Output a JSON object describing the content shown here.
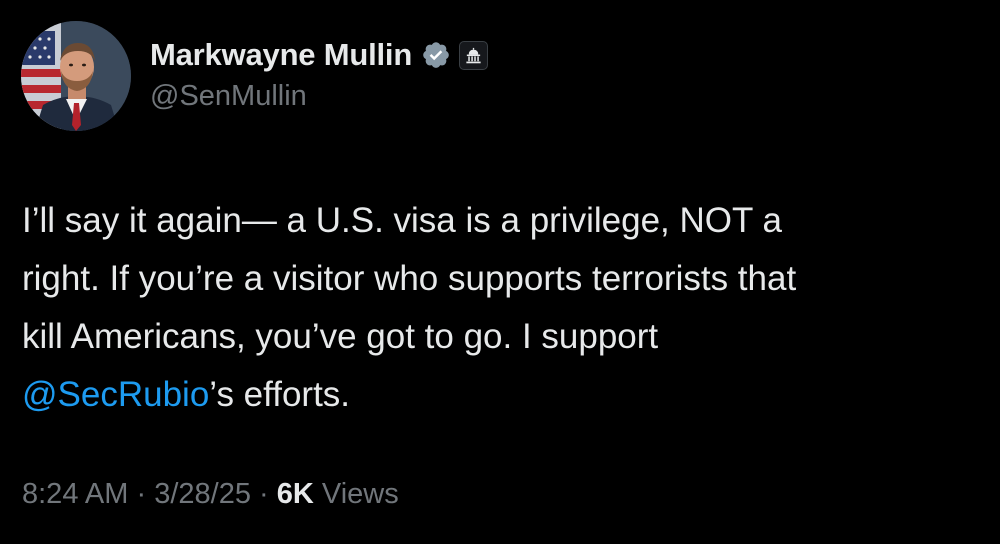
{
  "author": {
    "display_name": "Markwayne Mullin",
    "handle": "@SenMullin",
    "verified_icon": "verified-checkmark-icon",
    "affiliation_icon": "government-building-icon",
    "verified_color": "#8899a6"
  },
  "tweet": {
    "lines": [
      "I’ll say it again— a U.S. visa is a privilege, NOT a",
      "right. If you’re a visitor who supports terrorists that",
      "kill Americans, you’ve got to go. I support"
    ],
    "mention": "@SecRubio",
    "after_mention": "’s efforts."
  },
  "meta": {
    "time": "8:24 AM",
    "separator": "·",
    "date": "3/28/25",
    "views_count": "6K",
    "views_label": "Views"
  },
  "colors": {
    "background": "#000000",
    "text": "#e7e9ea",
    "secondary": "#71767b",
    "link": "#1d9bf0"
  }
}
